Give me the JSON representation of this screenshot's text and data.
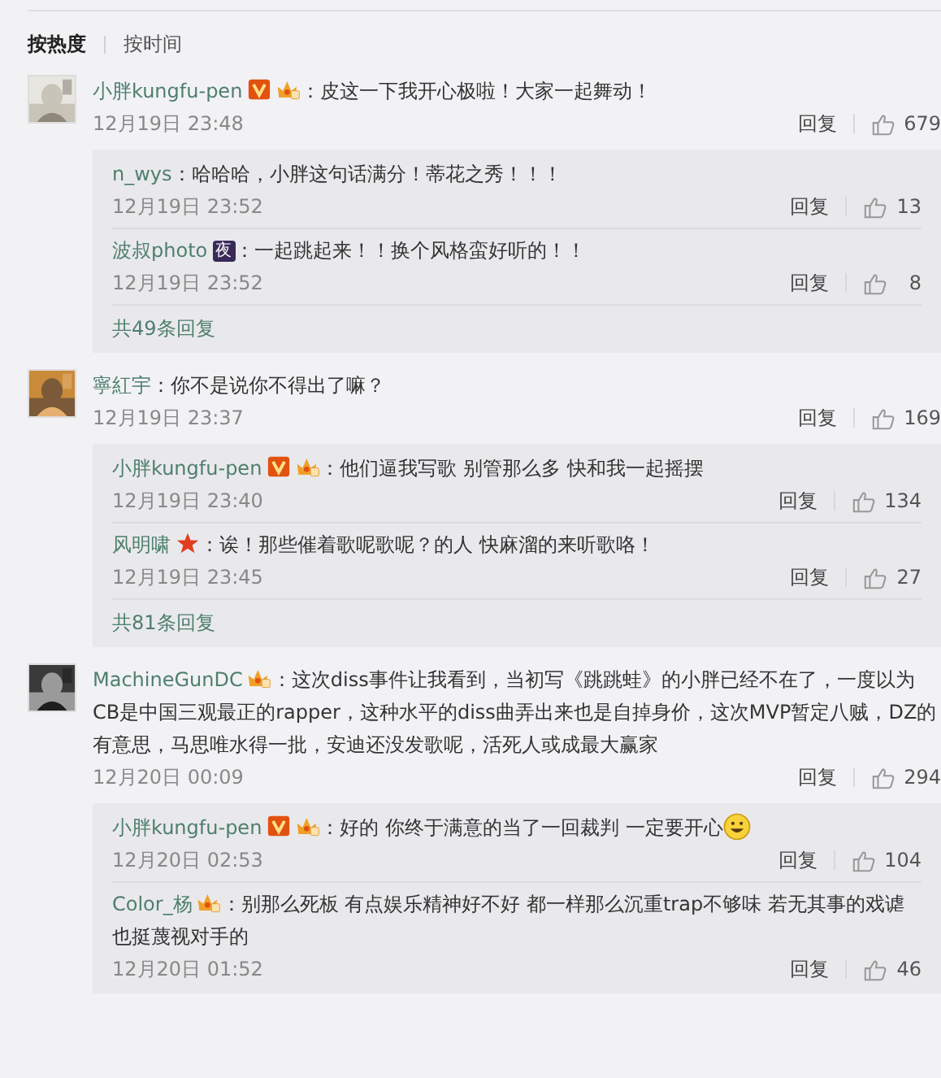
{
  "sort_tabs": [
    {
      "label": "按热度",
      "selected": true
    },
    {
      "label": "按时间",
      "selected": false
    }
  ],
  "comments": [
    {
      "user": "小胖kungfu-pen",
      "badges": [
        {
          "kind": "verified"
        },
        {
          "kind": "level"
        }
      ],
      "text": "：皮这一下我开心极啦！大家一起舞动！",
      "time": "12月19日 23:48",
      "reply": "回复",
      "likes": "679",
      "replies": [
        {
          "user": "n_wys",
          "text": "：哈哈哈，小胖这句话满分！蒂花之秀！！！",
          "time": "12月19日 23:52",
          "reply": "回复",
          "likes": "13"
        },
        {
          "user": "波叔photo",
          "badges": [
            {
              "kind": "tag",
              "text": "夜"
            }
          ],
          "text": "：一起跳起来！！换个风格蛮好听的！！",
          "time": "12月19日 23:52",
          "reply": "回复",
          "likes": "8"
        }
      ],
      "more": "共49条回复"
    },
    {
      "user": "寧紅宇",
      "text": "：你不是说你不得出了嘛？",
      "time": "12月19日 23:37",
      "reply": "回复",
      "likes": "169",
      "replies": [
        {
          "user": "小胖kungfu-pen",
          "badges": [
            {
              "kind": "verified"
            },
            {
              "kind": "level"
            }
          ],
          "text": "：他们逼我写歌 别管那么多 快和我一起摇摆",
          "time": "12月19日 23:40",
          "reply": "回复",
          "likes": "134"
        },
        {
          "user": "风明啸",
          "badges": [
            {
              "kind": "star"
            }
          ],
          "text": "：诶！那些催着歌呢歌呢？的人 快麻溜的来听歌咯！",
          "time": "12月19日 23:45",
          "reply": "回复",
          "likes": "27"
        }
      ],
      "more": "共81条回复"
    },
    {
      "user": "MachineGunDC",
      "badges": [
        {
          "kind": "level"
        }
      ],
      "text": "：这次diss事件让我看到，当初写《跳跳蛙》的小胖已经不在了，一度以为CB是中国三观最正的rapper，这种水平的diss曲弄出来也是自掉身价，这次MVP暂定八贼，DZ的有意思，马思唯水得一批，安迪还没发歌呢，活死人或成最大赢家",
      "time": "12月20日 00:09",
      "reply": "回复",
      "likes": "294",
      "replies": [
        {
          "user": "小胖kungfu-pen",
          "badges": [
            {
              "kind": "verified"
            },
            {
              "kind": "level"
            }
          ],
          "text": "：好的 你终于满意的当了一回裁判 一定要开心",
          "emoji": true,
          "time": "12月20日 02:53",
          "reply": "回复",
          "likes": "104"
        },
        {
          "user": "Color_杨",
          "badges": [
            {
              "kind": "level"
            }
          ],
          "text": "：别那么死板 有点娱乐精神好不好 都一样那么沉重trap不够味 若无其事的戏谑也挺蔑视对手的",
          "time": "12月20日 01:52",
          "reply": "回复",
          "likes": "46"
        }
      ]
    }
  ]
}
